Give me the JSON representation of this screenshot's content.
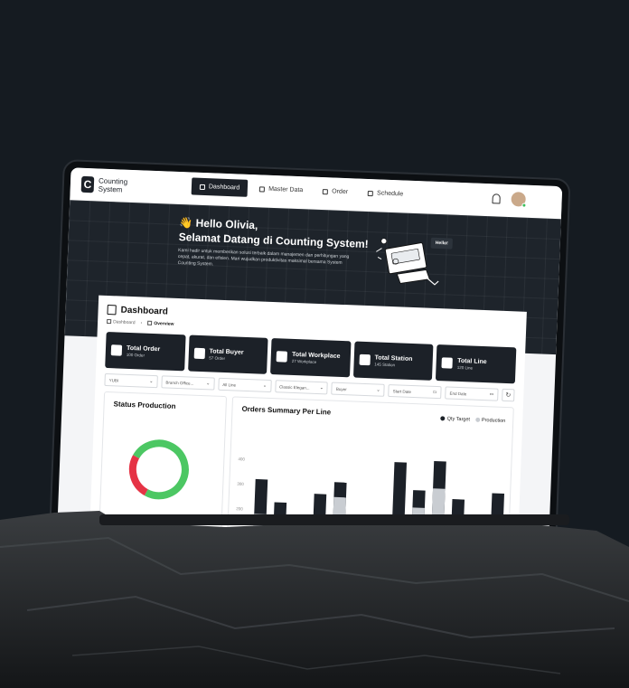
{
  "app": {
    "logo_line1": "Counting",
    "logo_line2": "System",
    "logo_letter": "C"
  },
  "nav": [
    {
      "label": "Dashboard",
      "active": true
    },
    {
      "label": "Master Data",
      "active": false
    },
    {
      "label": "Order",
      "active": false
    },
    {
      "label": "Schedule",
      "active": false
    }
  ],
  "hero": {
    "greeting": "👋 Hello Olivia,",
    "welcome": "Selamat Datang di Counting System!",
    "description": "Kami hadir untuk memberikan solusi terbaik dalam manajemen dan perhitungan yang cepat, akurat, dan efisien. Mari wujudkan produktivitas maksimal bersama System Counting System.",
    "badge": "Hello!"
  },
  "dashboard": {
    "title": "Dashboard",
    "breadcrumb": [
      "Dashboard",
      "Overview"
    ]
  },
  "stats": [
    {
      "title": "Total Order",
      "sub": "100 Order",
      "icon": "document-icon"
    },
    {
      "title": "Total Buyer",
      "sub": "57 Order",
      "icon": "user-icon"
    },
    {
      "title": "Total Workplace",
      "sub": "27 Workplace",
      "icon": "home-icon"
    },
    {
      "title": "Total Station",
      "sub": "145 Station",
      "icon": "station-icon"
    },
    {
      "title": "Total Line",
      "sub": "120 Line",
      "icon": "line-icon"
    }
  ],
  "filters": [
    {
      "value": "YUBI",
      "chevron": "⌄"
    },
    {
      "value": "Branch Office...",
      "chevron": "⌄"
    },
    {
      "value": "All Line",
      "chevron": "⌄"
    },
    {
      "value": "Classic Elegan...",
      "chevron": "⌄"
    },
    {
      "value": "Buyer",
      "chevron": "⌄"
    },
    {
      "value": "Start Date",
      "chevron": "▭"
    },
    {
      "value": "End Date",
      "chevron": "▭"
    }
  ],
  "refresh_glyph": "↻",
  "status_production": {
    "title": "Status Production",
    "chart_data": {
      "type": "pie",
      "segments": [
        {
          "value": 75,
          "color": "#4cc763"
        },
        {
          "value": 25,
          "color": "#e53345"
        }
      ]
    }
  },
  "orders_summary": {
    "title": "Orders Summary Per Line",
    "legend": [
      {
        "label": "Qty Target",
        "color": "#1c2128"
      },
      {
        "label": "Production",
        "color": "#c9cdd2"
      }
    ],
    "chart_data": {
      "type": "bar",
      "ylim": [
        100,
        500
      ],
      "ticks": [
        "400",
        "300",
        "200"
      ],
      "series": [
        {
          "name": "Qty Target",
          "values": [
            320,
            230,
            0,
            270,
            320,
            0,
            0,
            410,
            300,
            420,
            270,
            210,
            300
          ],
          "color": "#1c2128"
        },
        {
          "name": "Production",
          "values": [
            180,
            140,
            0,
            180,
            260,
            0,
            0,
            160,
            230,
            310,
            170,
            140,
            180
          ],
          "color": "#c9cdd2"
        }
      ]
    }
  }
}
